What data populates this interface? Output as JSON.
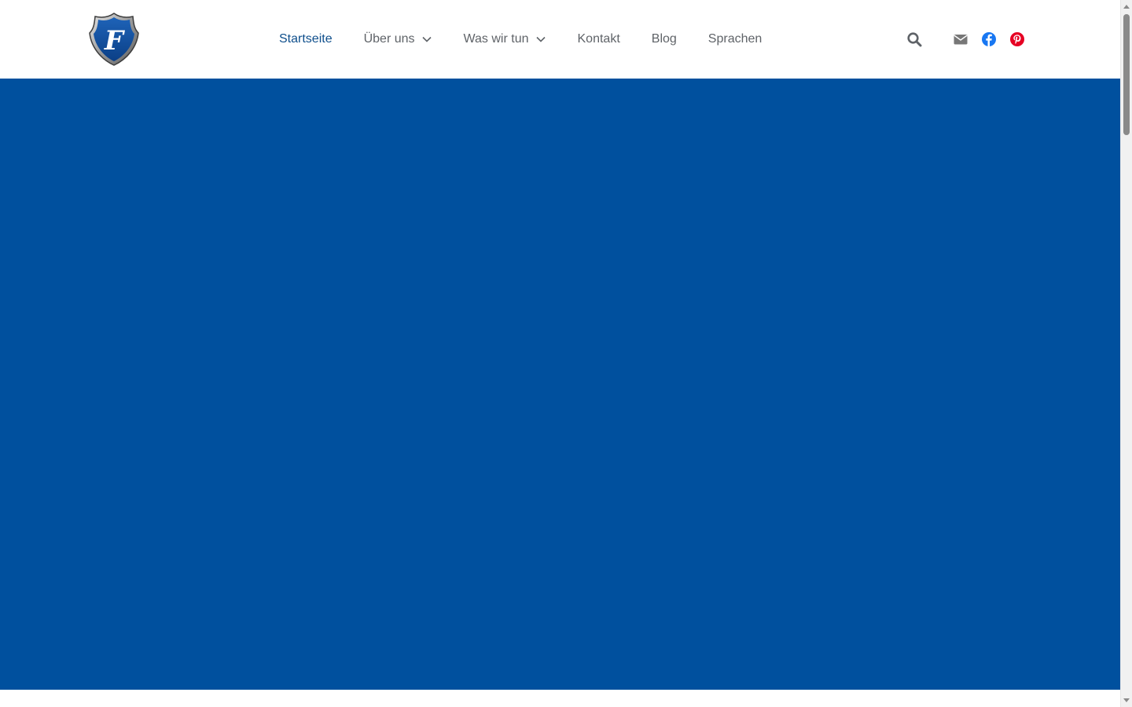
{
  "brand": {
    "logo_letter": "F",
    "logo_icon": "shield-logo-icon"
  },
  "nav": {
    "items": [
      {
        "label": "Startseite",
        "active": true,
        "has_dropdown": false
      },
      {
        "label": "Über uns",
        "active": false,
        "has_dropdown": true
      },
      {
        "label": "Was wir tun",
        "active": false,
        "has_dropdown": true
      },
      {
        "label": "Kontakt",
        "active": false,
        "has_dropdown": false
      },
      {
        "label": "Blog",
        "active": false,
        "has_dropdown": false
      },
      {
        "label": "Sprachen",
        "active": false,
        "has_dropdown": false
      }
    ]
  },
  "header_actions": {
    "search_icon": "search-icon",
    "email_icon": "email-icon",
    "facebook_icon": "facebook-icon",
    "pinterest_icon": "pinterest-icon"
  },
  "colors": {
    "hero_background": "#00509e",
    "nav_active": "#0f4f8c",
    "nav_text": "#5f6368",
    "facebook": "#1877f2",
    "pinterest": "#e60023",
    "email_icon": "#777777",
    "search_icon": "#5f6368"
  }
}
